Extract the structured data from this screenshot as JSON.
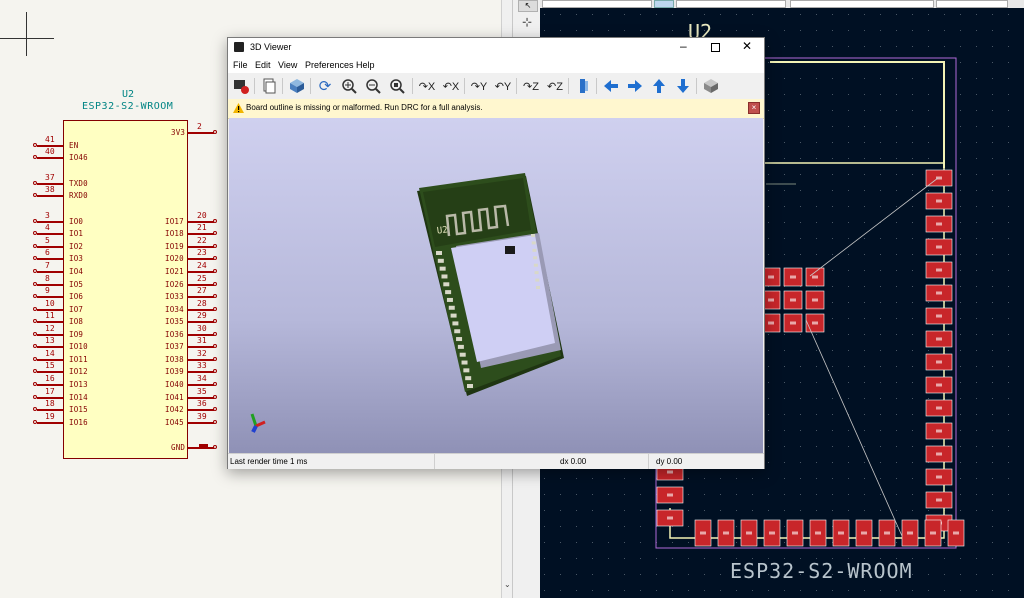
{
  "schematic": {
    "ref": "U2",
    "value": "ESP32-S2-WROOM",
    "pins_left": [
      {
        "num": "41",
        "name": "EN"
      },
      {
        "num": "40",
        "name": "IO46"
      },
      {
        "num": "37",
        "name": "TXD0"
      },
      {
        "num": "38",
        "name": "RXD0"
      },
      {
        "num": "3",
        "name": "IO0"
      },
      {
        "num": "4",
        "name": "IO1"
      },
      {
        "num": "5",
        "name": "IO2"
      },
      {
        "num": "6",
        "name": "IO3"
      },
      {
        "num": "7",
        "name": "IO4"
      },
      {
        "num": "8",
        "name": "IO5"
      },
      {
        "num": "9",
        "name": "IO6"
      },
      {
        "num": "10",
        "name": "IO7"
      },
      {
        "num": "11",
        "name": "IO8"
      },
      {
        "num": "12",
        "name": "IO9"
      },
      {
        "num": "13",
        "name": "IO10"
      },
      {
        "num": "14",
        "name": "IO11"
      },
      {
        "num": "15",
        "name": "IO12"
      },
      {
        "num": "16",
        "name": "IO13"
      },
      {
        "num": "17",
        "name": "IO14"
      },
      {
        "num": "18",
        "name": "IO15"
      },
      {
        "num": "19",
        "name": "IO16"
      }
    ],
    "pins_right": [
      {
        "num": "2",
        "name": "3V3"
      },
      {
        "num": "20",
        "name": "IO17"
      },
      {
        "num": "21",
        "name": "IO18"
      },
      {
        "num": "22",
        "name": "IO19"
      },
      {
        "num": "23",
        "name": "IO20"
      },
      {
        "num": "24",
        "name": "IO21"
      },
      {
        "num": "25",
        "name": "IO26"
      },
      {
        "num": "27",
        "name": "IO33"
      },
      {
        "num": "28",
        "name": "IO34"
      },
      {
        "num": "29",
        "name": "IO35"
      },
      {
        "num": "30",
        "name": "IO36"
      },
      {
        "num": "31",
        "name": "IO37"
      },
      {
        "num": "32",
        "name": "IO38"
      },
      {
        "num": "33",
        "name": "IO39"
      },
      {
        "num": "34",
        "name": "IO40"
      },
      {
        "num": "35",
        "name": "IO41"
      },
      {
        "num": "36",
        "name": "IO42"
      },
      {
        "num": "39",
        "name": "IO45"
      },
      {
        "num": "",
        "name": "GND"
      }
    ]
  },
  "viewer": {
    "title": "3D Viewer",
    "menu": [
      "File",
      "Edit",
      "View",
      "Preferences",
      "Help"
    ],
    "warning": "Board outline is missing or malformed. Run DRC for a full analysis.",
    "status_left": "Last render time 1 ms",
    "status_dx": "dx 0.00",
    "status_dy": "dy 0.00",
    "board_label": "U2"
  },
  "pcb": {
    "ref": "U2",
    "value": "ESP32-S2-WROOM"
  },
  "colors": {
    "schematic_bg": "#f5f4ef",
    "symbol_fill": "#ffffc2",
    "pin_red": "#a00000",
    "pcb_bg": "#001023",
    "pad_red": "#c8262a",
    "courtyard": "#b06ad8",
    "silk": "#f2f2b5"
  }
}
